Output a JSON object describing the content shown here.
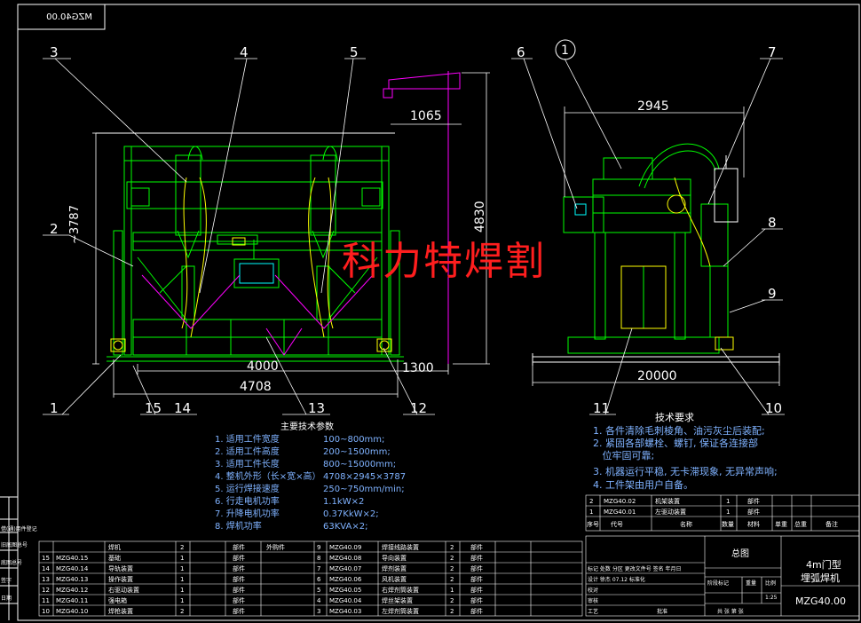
{
  "drawing_no_mirrored": "MZG40.00",
  "dimensions": {
    "height_front": "~3787",
    "crane_reach": "1065",
    "crane_height": "4830",
    "base_4000": "4000",
    "side_1300": "1300",
    "total_width": "4708",
    "side_width": "2945",
    "rail_length": "20000"
  },
  "balloons": [
    "1",
    "2",
    "3",
    "4",
    "5",
    "6",
    "7",
    "8",
    "9",
    "10",
    "11",
    "12",
    "13",
    "14",
    "15"
  ],
  "watermark": "科力特焊割",
  "main_params": {
    "title": "主要技术参数",
    "rows": [
      {
        "label": "1. 适用工件宽度",
        "value": "100~800mm;"
      },
      {
        "label": "2. 适用工件高度",
        "value": "200~1500mm;"
      },
      {
        "label": "3. 适用工件长度",
        "value": "800~15000mm;"
      },
      {
        "label": "4. 整机外形（长×宽×高）",
        "value": "4708×2945×3787"
      },
      {
        "label": "5. 运行焊接速度",
        "value": "250~750mm/min;"
      },
      {
        "label": "6. 行走电机功率",
        "value": "1.1kW×2"
      },
      {
        "label": "7. 升降电机功率",
        "value": "0.37KkW×2;"
      },
      {
        "label": "8. 焊机功率",
        "value": "63KVA×2;"
      }
    ]
  },
  "tech_req": {
    "title": "技术要求",
    "lines": [
      "1. 各件清除毛刺棱角、油污灰尘后装配;",
      "2. 紧固各部螺栓、螺钉, 保证各连接部",
      "   位牢固可靠;",
      "3. 机器运行平稳, 无卡滞现象, 无异常声响;",
      "4. 工件架由用户自备。"
    ]
  },
  "bom_right": {
    "rows": [
      [
        "2",
        "MZG40.02",
        "机架装置",
        "1",
        "部件"
      ],
      [
        "1",
        "MZG40.01",
        "左驱动装置",
        "1",
        "部件"
      ]
    ],
    "header": [
      "序号",
      "代号",
      "名称",
      "数量",
      "材料",
      "单重",
      "总重",
      "备注"
    ]
  },
  "bom_bottom": {
    "left": [
      [
        "",
        "",
        "焊机",
        "2",
        "",
        "部件"
      ],
      [
        "15",
        "MZG40.15",
        "基础",
        "1",
        "",
        "部件"
      ],
      [
        "14",
        "MZG40.14",
        "导轨装置",
        "1",
        "",
        "部件"
      ],
      [
        "13",
        "MZG40.13",
        "操作装置",
        "1",
        "",
        "部件"
      ],
      [
        "12",
        "MZG40.12",
        "右驱动装置",
        "1",
        "",
        "部件"
      ],
      [
        "11",
        "MZG40.11",
        "强电箱",
        "1",
        "",
        "部件"
      ],
      [
        "10",
        "MZG40.10",
        "焊枪装置",
        "2",
        "",
        "部件"
      ]
    ],
    "mid_label": "外购件",
    "right": [
      [
        "9",
        "MZG40.09",
        "焊接线路装置",
        "2",
        "部件"
      ],
      [
        "8",
        "MZG40.08",
        "导向装置",
        "2",
        "部件"
      ],
      [
        "7",
        "MZG40.07",
        "焊剂装置",
        "2",
        "部件"
      ],
      [
        "6",
        "MZG40.06",
        "风机装置",
        "2",
        "部件"
      ],
      [
        "5",
        "MZG40.05",
        "右焊剂筒装置",
        "1",
        "部件"
      ],
      [
        "4",
        "MZG40.04",
        "焊丝架装置",
        "2",
        "部件"
      ],
      [
        "3",
        "MZG40.03",
        "左焊剂筒装置",
        "2",
        "部件"
      ]
    ]
  },
  "title_block": {
    "total_title": "总图",
    "product_line1": "4m门型",
    "product_line2": "埋弧焊机",
    "drawing_no": "MZG40.00",
    "rows": [
      "标记 处数 分区 更改文件号 签名 年月日",
      "设计 徐杰 07.12 标准化",
      "校对",
      "审核",
      "工艺",
      "批准"
    ],
    "stage": "阶段标记",
    "weight": "重量",
    "ratio": "比例",
    "scale": "1:25",
    "sheets": "共  张  第  张"
  },
  "left_margin_labels": [
    "借(通)用件登记",
    "旧底图总号",
    "底图总号",
    "签字",
    "日期"
  ],
  "colors": {
    "green": "#00ff00",
    "white": "#ffffff",
    "yellow": "#ffff00",
    "magenta": "#ff00ff",
    "cyan": "#00ffff",
    "red": "#ff1e1e",
    "blue_text": "#7fb2ff"
  }
}
